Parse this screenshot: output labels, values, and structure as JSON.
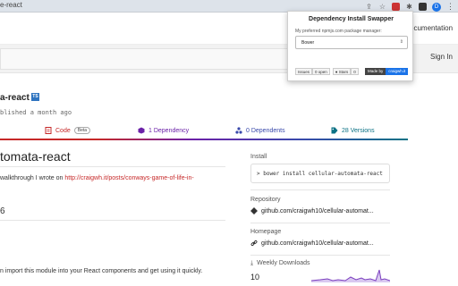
{
  "browser": {
    "url_fragment": "e-react",
    "profile_initial": "D",
    "menu_glyph": "⋮"
  },
  "nav": {
    "documentation": "ocumentation",
    "sign_in": "Sign In"
  },
  "package": {
    "name": "a-react",
    "ts_badge": "TS",
    "meta": "blished a month ago"
  },
  "tabs": [
    {
      "label": "Code",
      "badge": "Beta",
      "color": "#c62828",
      "icon": "code-file-icon"
    },
    {
      "label": "1 Dependency",
      "color": "#6b21a8",
      "icon": "box-icon"
    },
    {
      "label": "0 Dependents",
      "color": "#3949ab",
      "icon": "network-icon"
    },
    {
      "label": "28 Versions",
      "color": "#0b7285",
      "icon": "tags-icon"
    }
  ],
  "readme": {
    "title": "tomata-react",
    "line1_prefix": "walkthrough I wrote on ",
    "line1_link": "http://craigwh.it/posts/conways-game-of-life-in-",
    "heading_num": "6",
    "line2": "n import this module into your React components and get using it quickly."
  },
  "sidebar": {
    "install_label": "Install",
    "install_cmd": "> bower install cellular-automata-react",
    "repository_label": "Repository",
    "repository_value": "github.com/craigwh10/cellular-automat...",
    "homepage_label": "Homepage",
    "homepage_value": "github.com/craigwh10/cellular-automat...",
    "downloads_label": "Weekly Downloads",
    "downloads_value": "10"
  },
  "popup": {
    "title": "Dependency Install Swapper",
    "subtitle": "My preferred npmjs.com package manager:",
    "selected": "Bower",
    "issues_label": "Issues",
    "issues_count": "0 open",
    "stars_label": "Stars",
    "stars_count": "0",
    "made_by_label": "Made by",
    "made_by_value": "craigwh.it"
  }
}
